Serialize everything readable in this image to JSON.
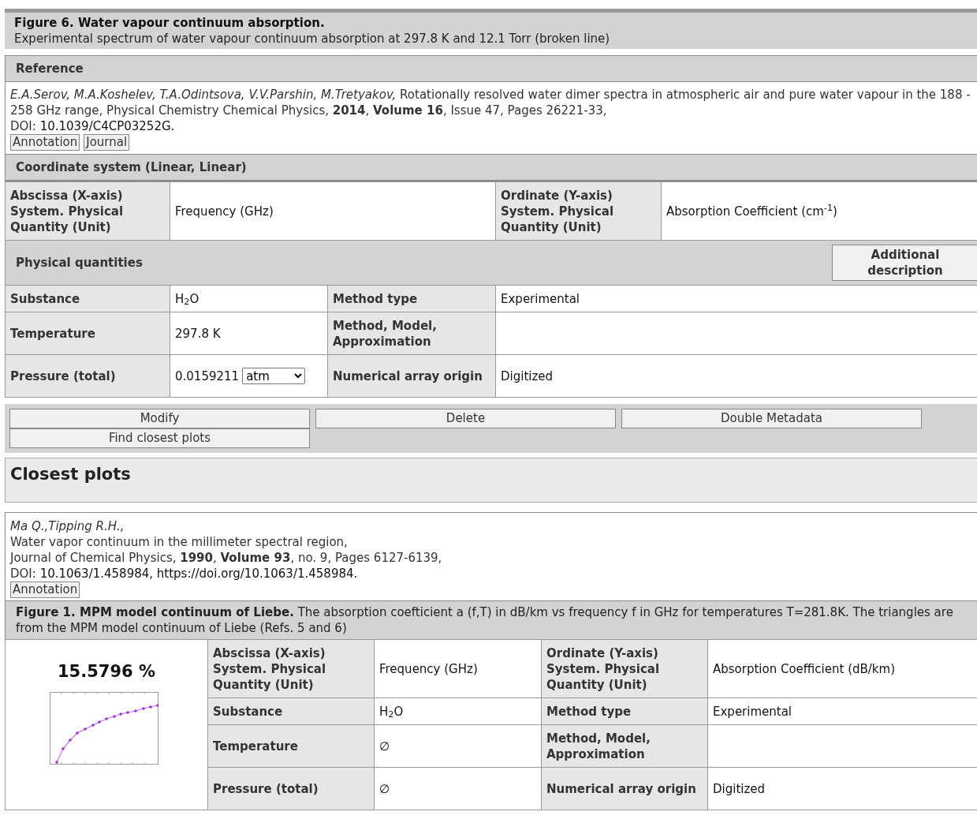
{
  "figure": {
    "title": "Figure 6. Water vapour continuum absorption.",
    "caption": "Experimental spectrum of water vapour continuum absorption at 297.8 K and 12.1 Torr (broken line)"
  },
  "reference": {
    "header": "Reference",
    "citation": "*E.A.Serov, M.A.Koshelev, T.A.Odintsova, V.V.Parshin, M.Tretyakov,* Rotationally resolved water dimer spectra in atmospheric air and pure water vapour in the 188 - 258 GHz range, Physical Chemistry Chemical Physics, **2014**, **Volume 16**, Issue 47, Pages 26221-33,",
    "doi_label": "DOI:",
    "doi": "10.1039/C4CP03252G.",
    "buttons": [
      "Annotation",
      "Journal"
    ]
  },
  "coordinate_system": {
    "header": "Coordinate system (Linear, Linear)",
    "x_label": "Abscissa (X-axis) System. Physical Quantity (Unit)",
    "x_value": "Frequency (GHz)",
    "y_label": "Ordinate (Y-axis) System. Physical Quantity (Unit)",
    "y_value": "Absorption Coefficient (cm$^{-1}$)"
  },
  "physical_quantities": {
    "header": "Physical quantities",
    "button": "Additional description",
    "rows": [
      {
        "label": "Substance",
        "value": "H$_{2}$O",
        "label2": "Method type",
        "value2": "Experimental"
      },
      {
        "label": "Temperature",
        "value": "297.8 K",
        "label2": "Method, Model, Approximation",
        "value2": ""
      },
      {
        "label": "Pressure (total)",
        "value": "0.0159211",
        "unit": "atm",
        "label2": "Numerical array origin",
        "value2": "Digitized"
      }
    ]
  },
  "actions": [
    "Modify",
    "Delete",
    "Double Metadata",
    "Find closest plots"
  ],
  "closest": {
    "header": "Closest plots",
    "entries": [
      {
        "citation": [
          "*Ma Q.,Tipping R.H.,*",
          "Water vapor continuum in the millimeter spectral region,",
          "Journal of Chemical Physics, **1990**, **Volume 93**, no. 9, Pages 6127-6139,"
        ],
        "doi_label": "DOI:",
        "doi": "10.1063/1.458984, https://doi.org/10.1063/1.458984.",
        "buttons": [
          "Annotation"
        ],
        "figure_caption": "**Figure 1. MPM model continuum of Liebe.** The absorption coefticient a (f,T) in dB/km vs frequency f in GHz for temperatures T=281.8K. The triangles are from the MPM model continuum of Liebe (Refs. 5 and 6)",
        "similarity": "15.5796 %",
        "x_label": "Abscissa (X-axis) System. Physical Quantity (Unit)",
        "x_value": "Frequency (GHz)",
        "y_label": "Ordinate (Y-axis) System. Physical Quantity (Unit)",
        "y_value": "Absorption Coefficient (dB/km)",
        "rows": [
          {
            "label": "Substance",
            "value": "H$_{2}$O",
            "label2": "Method type",
            "value2": "Experimental"
          },
          {
            "label": "Temperature",
            "value": "∅",
            "label2": "Method, Model, Approximation",
            "value2": ""
          },
          {
            "label": "Pressure (total)",
            "value": "∅",
            "label2": "Numerical array origin",
            "value2": "Digitized"
          }
        ]
      }
    ]
  }
}
